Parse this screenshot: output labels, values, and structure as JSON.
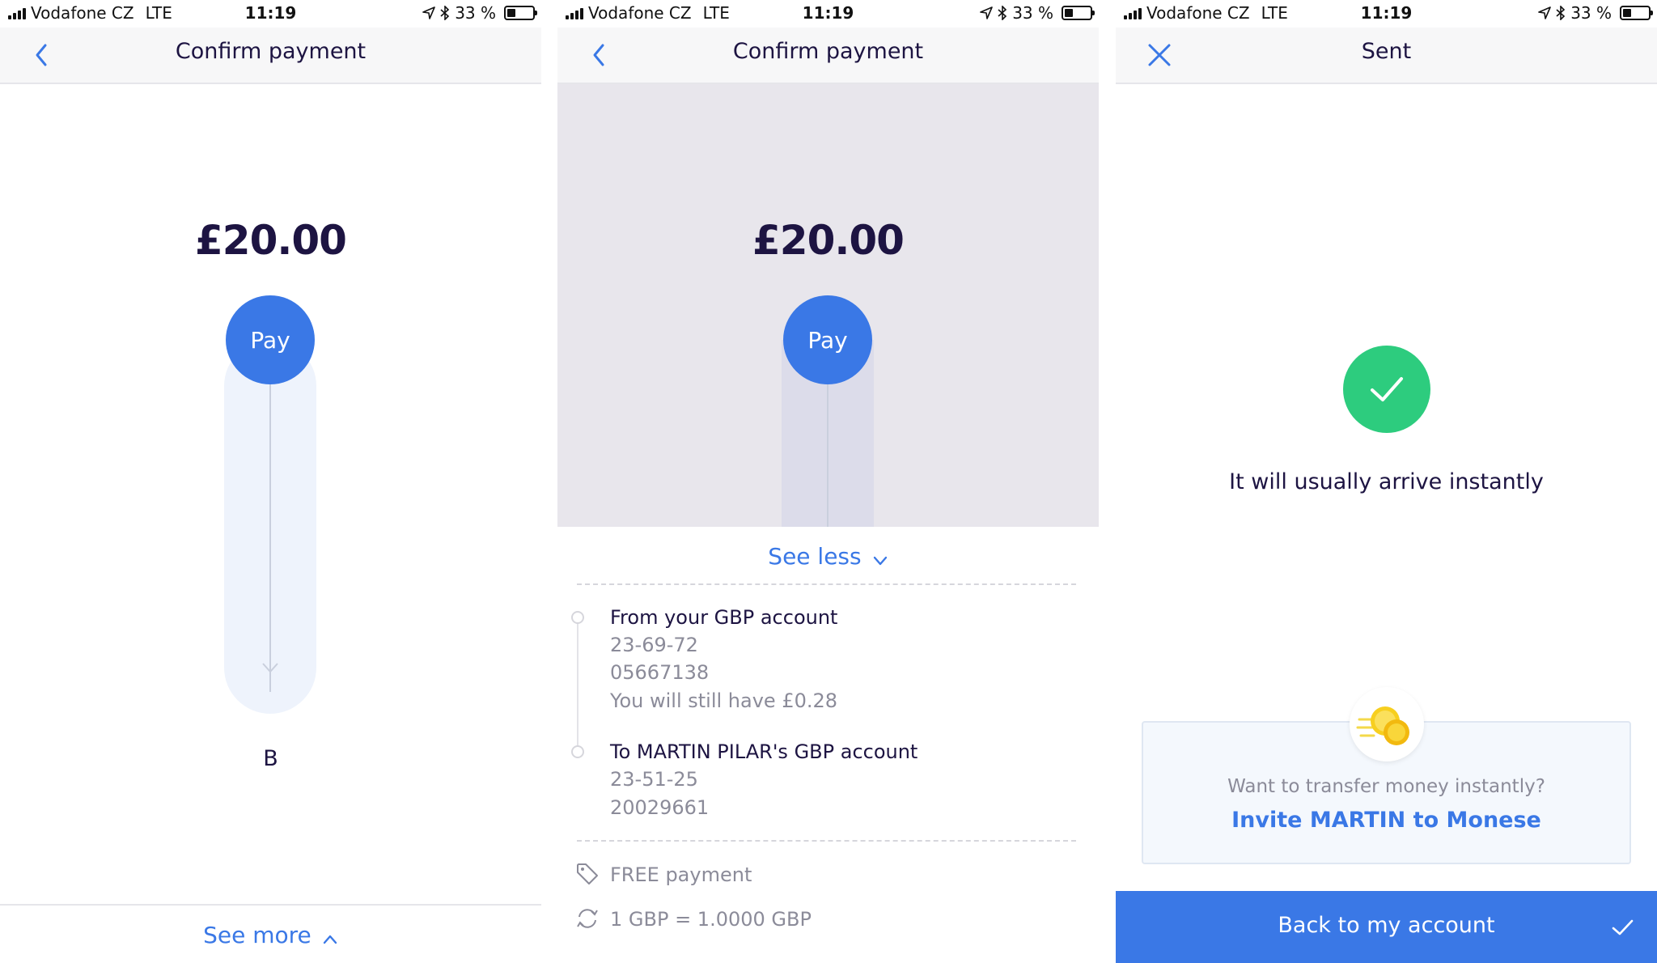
{
  "statusbar": {
    "carrier": "Vodafone CZ",
    "network": "LTE",
    "time": "11:19",
    "battery": "33 %"
  },
  "screen1": {
    "title": "Confirm payment",
    "amount": "£20.00",
    "pay_label": "Pay",
    "bottom_label": "B",
    "see_more_label": "See more"
  },
  "screen2": {
    "title": "Confirm payment",
    "amount": "£20.00",
    "pay_label": "Pay",
    "see_less_label": "See less",
    "from": {
      "title": "From your GBP account",
      "sort_code": "23-69-72",
      "account_number": "05667138",
      "remaining": "You will still have £0.28"
    },
    "to": {
      "title": "To MARTIN PILAR's GBP account",
      "sort_code": "23-51-25",
      "account_number": "20029661"
    },
    "fee": "FREE payment",
    "rate": "1 GBP = 1.0000 GBP"
  },
  "screen3": {
    "title": "Sent",
    "arrival_message": "It will usually arrive instantly",
    "invite_question": "Want to transfer money instantly?",
    "invite_link": "Invite MARTIN to Monese",
    "cta_label": "Back to my account"
  },
  "colors": {
    "accent": "#3a78e6",
    "success": "#2dcc7e",
    "text_dark": "#1d1442",
    "text_muted": "#8b8b99"
  }
}
